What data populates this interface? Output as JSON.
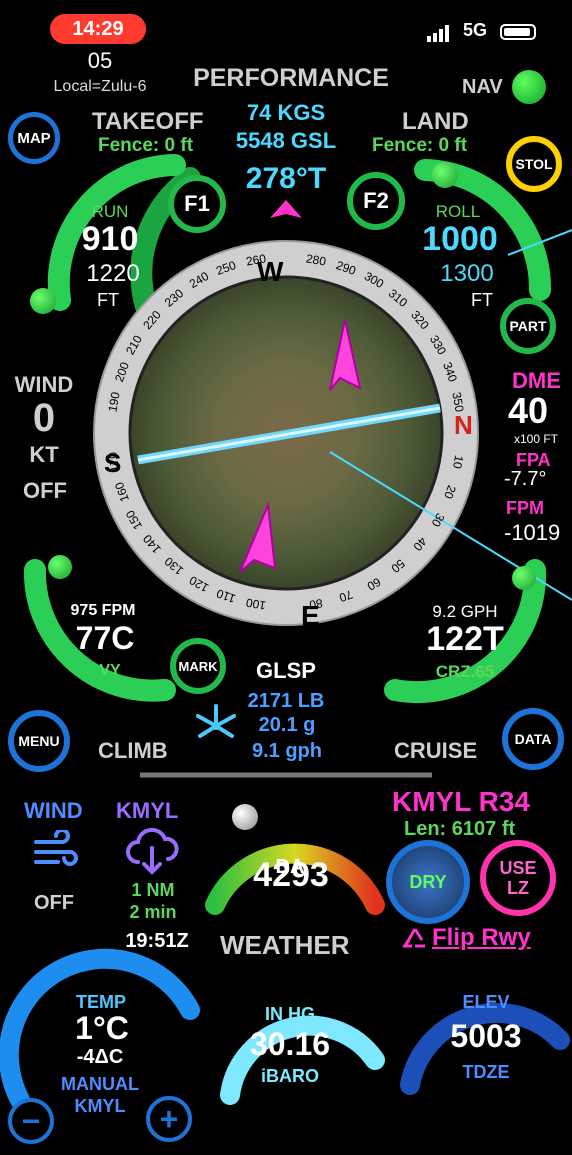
{
  "status_bar": {
    "time": "14:29",
    "signal": "5G"
  },
  "header": {
    "day": "05",
    "local": "Local=Zulu-6",
    "title": "PERFORMANCE",
    "nav_label": "NAV",
    "weight": "74 KGS",
    "gsl": "5548 GSL",
    "heading": "278°T"
  },
  "takeoff": {
    "title": "TAKEOFF",
    "fence": "Fence: 0 ft",
    "run_label": "RUN",
    "run_value": "910",
    "total": "1220",
    "unit": "FT"
  },
  "land": {
    "title": "LAND",
    "fence": "Fence: 0 ft",
    "roll_label": "ROLL",
    "roll_value": "1000",
    "total": "1300",
    "unit": "FT"
  },
  "buttons": {
    "map": "MAP",
    "stol": "STOL",
    "f1": "F1",
    "f2": "F2",
    "part": "PART",
    "mark": "MARK",
    "menu": "MENU",
    "data": "DATA",
    "dry": "DRY",
    "use_lz_1": "USE",
    "use_lz_2": "LZ",
    "minus": "−",
    "plus": "+"
  },
  "wind_left": {
    "label": "WIND",
    "value": "0",
    "unit": "KT",
    "state": "OFF"
  },
  "dme": {
    "label": "DME",
    "value": "40",
    "unit": "x100 FT",
    "fpa_label": "FPA",
    "fpa_value": "-7.7°",
    "fpm_label": "FPM",
    "fpm_value": "-1019"
  },
  "compass": {
    "cardinals": {
      "W": "W",
      "N": "N",
      "E": "E",
      "S": "S"
    },
    "ticks": [
      "280",
      "290",
      "300",
      "310",
      "320",
      "330",
      "340",
      "350",
      "10",
      "20",
      "30",
      "40",
      "50",
      "60",
      "70",
      "80",
      "100",
      "110",
      "120",
      "130",
      "140",
      "150",
      "160",
      "170",
      "190",
      "200",
      "210",
      "220",
      "230",
      "240",
      "250",
      "260"
    ]
  },
  "climb": {
    "fpm": "975 FPM",
    "speed": "77C",
    "label": "VY",
    "title": "CLIMB"
  },
  "cruise": {
    "gph": "9.2 GPH",
    "speed": "122T",
    "label": "CRZ.65",
    "title": "CRUISE"
  },
  "glsp": {
    "title": "GLSP",
    "weight": "2171 LB",
    "g": "20.1 g",
    "gph": "9.1 gph"
  },
  "weather": {
    "wind_label": "WIND",
    "wind_state": "OFF",
    "station": "KMYL",
    "distance": "1 NM",
    "age": "2 min",
    "zulu": "19:51Z",
    "da_label": "DA",
    "da_value": "4293",
    "title": "WEATHER",
    "runway": "KMYL R34",
    "length": "Len: 6107 ft",
    "flip": "Flip Rwy",
    "temp_label": "TEMP",
    "temp_value": "1°C",
    "temp_delta": "-4ΔC",
    "temp_source": "MANUAL",
    "temp_station": "KMYL",
    "inhg_label": "IN HG",
    "inhg_value": "30.16",
    "inhg_source": "iBARO",
    "elev_label": "ELEV",
    "elev_value": "5003",
    "elev_source": "TDZE"
  },
  "colors": {
    "green": "#22b84a",
    "cyan": "#4dd9ff",
    "magenta": "#ff33cc",
    "blue": "#1e73d8",
    "yellow": "#ffd000",
    "label_green": "#5cd65c"
  }
}
